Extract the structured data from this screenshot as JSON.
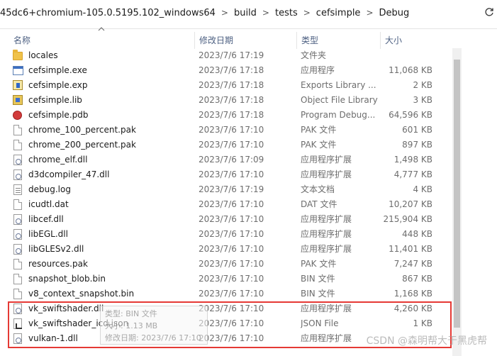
{
  "address_bar": {
    "crumbs": [
      "45dc6+chromium-105.0.5195.102_windows64",
      "build",
      "tests",
      "cefsimple",
      "Debug"
    ],
    "separator": ">",
    "refresh_icon": "refresh-icon"
  },
  "columns": {
    "name": "名称",
    "date": "修改日期",
    "type": "类型",
    "size": "大小"
  },
  "files": [
    {
      "name": "locales",
      "date": "2023/7/6 17:19",
      "type": "文件夹",
      "size": "",
      "icon": "folder-icon"
    },
    {
      "name": "cefsimple.exe",
      "date": "2023/7/6 17:18",
      "type": "应用程序",
      "size": "11,068 KB",
      "icon": "exe-icon"
    },
    {
      "name": "cefsimple.exp",
      "date": "2023/7/6 17:18",
      "type": "Exports Library ...",
      "size": "2 KB",
      "icon": "exp-icon"
    },
    {
      "name": "cefsimple.lib",
      "date": "2023/7/6 17:18",
      "type": "Object File Library",
      "size": "3 KB",
      "icon": "lib-icon"
    },
    {
      "name": "cefsimple.pdb",
      "date": "2023/7/6 17:18",
      "type": "Program Debug...",
      "size": "64,596 KB",
      "icon": "pdb-icon"
    },
    {
      "name": "chrome_100_percent.pak",
      "date": "2023/7/6 17:10",
      "type": "PAK 文件",
      "size": "601 KB",
      "icon": "file-icon"
    },
    {
      "name": "chrome_200_percent.pak",
      "date": "2023/7/6 17:10",
      "type": "PAK 文件",
      "size": "897 KB",
      "icon": "file-icon"
    },
    {
      "name": "chrome_elf.dll",
      "date": "2023/7/6 17:09",
      "type": "应用程序扩展",
      "size": "1,498 KB",
      "icon": "dll-icon"
    },
    {
      "name": "d3dcompiler_47.dll",
      "date": "2023/7/6 17:10",
      "type": "应用程序扩展",
      "size": "4,777 KB",
      "icon": "dll-icon"
    },
    {
      "name": "debug.log",
      "date": "2023/7/6 17:19",
      "type": "文本文档",
      "size": "4 KB",
      "icon": "log-icon"
    },
    {
      "name": "icudtl.dat",
      "date": "2023/7/6 17:10",
      "type": "DAT 文件",
      "size": "10,207 KB",
      "icon": "file-icon"
    },
    {
      "name": "libcef.dll",
      "date": "2023/7/6 17:10",
      "type": "应用程序扩展",
      "size": "215,904 KB",
      "icon": "dll-icon"
    },
    {
      "name": "libEGL.dll",
      "date": "2023/7/6 17:10",
      "type": "应用程序扩展",
      "size": "448 KB",
      "icon": "dll-icon"
    },
    {
      "name": "libGLESv2.dll",
      "date": "2023/7/6 17:10",
      "type": "应用程序扩展",
      "size": "11,401 KB",
      "icon": "dll-icon"
    },
    {
      "name": "resources.pak",
      "date": "2023/7/6 17:10",
      "type": "PAK 文件",
      "size": "7,247 KB",
      "icon": "file-icon"
    },
    {
      "name": "snapshot_blob.bin",
      "date": "2023/7/6 17:10",
      "type": "BIN 文件",
      "size": "867 KB",
      "icon": "file-icon"
    },
    {
      "name": "v8_context_snapshot.bin",
      "date": "2023/7/6 17:10",
      "type": "BIN 文件",
      "size": "1,168 KB",
      "icon": "file-icon"
    },
    {
      "name": "vk_swiftshader.dll",
      "date": "2023/7/6 17:10",
      "type": "应用程序扩展",
      "size": "4,260 KB",
      "icon": "dll-icon"
    },
    {
      "name": "vk_swiftshader_icd.json",
      "date": "2023/7/6 17:10",
      "type": "JSON File",
      "size": "1 KB",
      "icon": "json-icon"
    },
    {
      "name": "vulkan-1.dll",
      "date": "2023/7/6 17:10",
      "type": "应用程序扩展",
      "size": "",
      "icon": "dll-icon"
    }
  ],
  "tooltip": {
    "line1": "类型: BIN 文件",
    "line2": "大小: 1.13 MB",
    "line3": "修改日期: 2023/7/6 17:10"
  },
  "watermark": "CSDN @森明帮大于黑虎帮",
  "colors": {
    "highlight_border": "#e53935",
    "header_text": "#4d6082"
  }
}
